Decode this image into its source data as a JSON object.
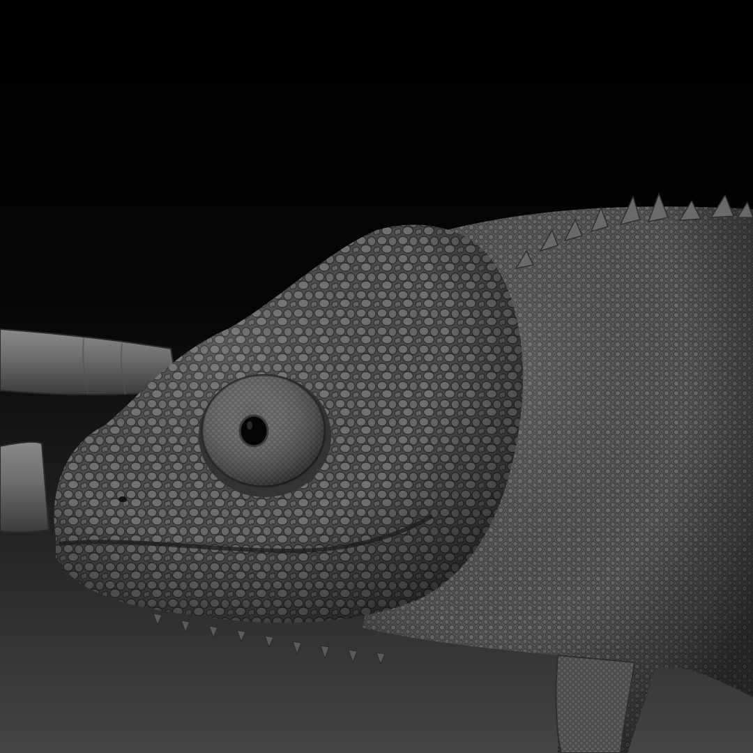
{
  "scene": {
    "subject": "chameleon-head-sculpt",
    "colors": {
      "background_top": "#000000",
      "background_bottom": "#454545",
      "skin_light": "#8c8c8c",
      "skin_mid": "#5b5b5b",
      "skin_dark": "#2c2c2c",
      "pupil": "#050505"
    }
  }
}
